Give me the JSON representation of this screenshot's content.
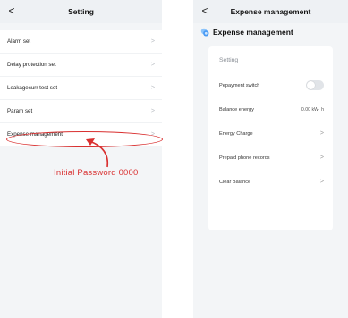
{
  "left": {
    "title": "Setting",
    "back": "<",
    "items": [
      {
        "label": "Alarm set",
        "chevron": ">"
      },
      {
        "label": "Delay protection set",
        "chevron": ">"
      },
      {
        "label": "Leakagecurr test set",
        "chevron": ">"
      },
      {
        "label": "Param set",
        "chevron": ">"
      },
      {
        "label": "Expense management",
        "chevron": ">"
      }
    ],
    "annotation": "Initial Password  0000"
  },
  "right": {
    "title": "Expense management",
    "back": "<",
    "section_title": "Expense management",
    "card_label": "Setting",
    "rows": [
      {
        "label": "Pepayment switch",
        "type": "toggle",
        "on": false
      },
      {
        "label": "Balance energy",
        "value": "0.00 kW· h"
      },
      {
        "label": "Energy Charge",
        "chevron": ">"
      },
      {
        "label": "Prepaid phone records",
        "chevron": ">"
      },
      {
        "label": "Clear Balance",
        "chevron": ">"
      }
    ]
  },
  "colors": {
    "annotation": "#d93030",
    "accent": "#4a9bf5",
    "background": "#f3f5f7"
  }
}
